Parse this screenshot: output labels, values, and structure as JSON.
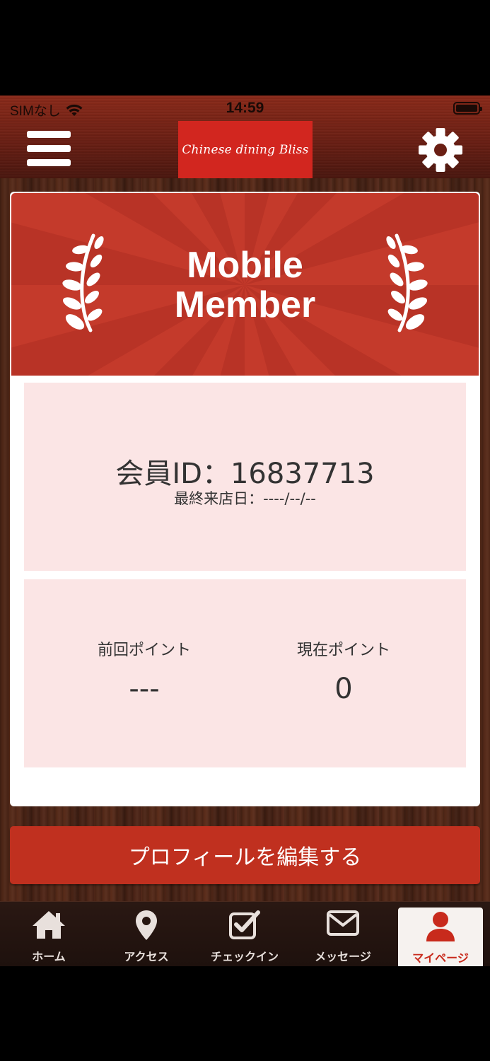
{
  "status_bar": {
    "carrier": "SIMなし",
    "time": "14:59"
  },
  "header": {
    "logo_text": "Chinese dining Bliss",
    "menu_icon": "hamburger-menu-icon",
    "settings_icon": "gear-icon"
  },
  "member_card": {
    "banner_line1": "Mobile",
    "banner_line2": "Member",
    "member_id": "会員ID：16837713",
    "last_visit": "最終来店日：----/--/--",
    "previous_points_label": "前回ポイント",
    "previous_points_value": "---",
    "current_points_label": "現在ポイント",
    "current_points_value": "0"
  },
  "edit_profile_label": "プロフィールを編集する",
  "tabs": [
    {
      "label": "ホーム",
      "icon": "home-icon",
      "active": false
    },
    {
      "label": "アクセス",
      "icon": "map-pin-icon",
      "active": false
    },
    {
      "label": "チェックイン",
      "icon": "checkin-icon",
      "active": false
    },
    {
      "label": "メッセージ",
      "icon": "envelope-icon",
      "active": false
    },
    {
      "label": "マイページ",
      "icon": "user-icon",
      "active": true
    }
  ],
  "colors": {
    "brand_red": "#c0301f",
    "logo_red": "#d2261f",
    "panel_pink": "#fbe5e5",
    "active_tab_label": "#c82a1c"
  }
}
